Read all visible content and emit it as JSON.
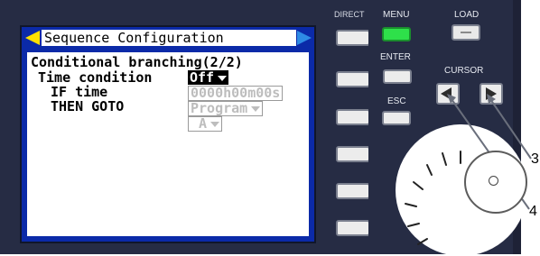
{
  "screen": {
    "title": "Sequence Configuration",
    "heading": "Conditional branching(2/2)",
    "rows": {
      "time_condition_label": "Time condition",
      "if_time_label": "IF time",
      "then_goto_label": "THEN GOTO"
    },
    "values": {
      "time_condition": "Off",
      "if_time": "0000h00m00s",
      "then_goto": "Program",
      "then_goto_target": "A"
    }
  },
  "panel": {
    "direct_label": "DIRECT",
    "menu_label": "MENU",
    "load_label": "LOAD",
    "enter_label": "ENTER",
    "cursor_label": "CURSOR",
    "esc_label": "ESC"
  },
  "callouts": {
    "three": "3",
    "four": "4"
  },
  "colors": {
    "title_bar": "#0b2aa8",
    "menu_led": "#2ee04a",
    "left_arrow": "#ffe100",
    "right_arrow": "#2e8be5"
  }
}
